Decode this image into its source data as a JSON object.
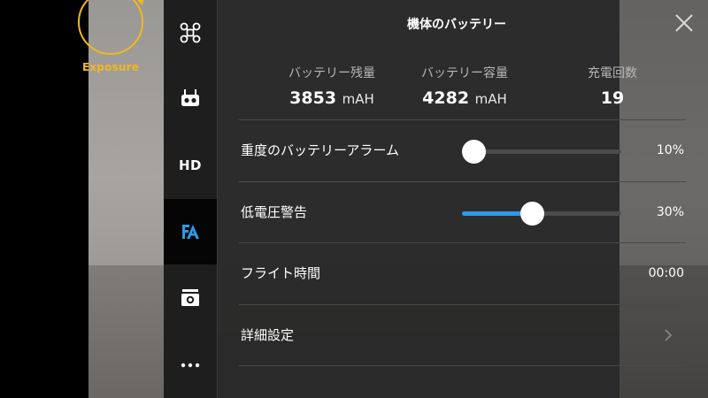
{
  "camera": {
    "exposure_label": "Exposure"
  },
  "sidebar": {
    "items": [
      {
        "id": "aircraft",
        "icon": "drone-icon"
      },
      {
        "id": "remote",
        "icon": "remote-controller-icon"
      },
      {
        "id": "hd",
        "label": "HD"
      },
      {
        "id": "battery",
        "icon": "battery-settings-icon",
        "active": true
      },
      {
        "id": "camera",
        "icon": "camera-icon"
      },
      {
        "id": "more",
        "icon": "more-icon"
      }
    ],
    "active_color": "#2b9ae8"
  },
  "panel": {
    "title": "機体のバッテリー",
    "stats": [
      {
        "label": "バッテリー残量",
        "value": "3853",
        "unit": "mAH"
      },
      {
        "label": "バッテリー容量",
        "value": "4282",
        "unit": "mAH"
      },
      {
        "label": "充電回数",
        "value": "19",
        "unit": ""
      }
    ],
    "rows": {
      "critical_alarm": {
        "label": "重度のバッテリーアラーム",
        "value": "10%",
        "level": 0.0
      },
      "low_voltage": {
        "label": "低電圧警告",
        "value": "30%",
        "level": 0.44
      },
      "flight_time": {
        "label": "フライト時間",
        "value": "00:00"
      },
      "advanced": {
        "label": "詳細設定"
      }
    }
  },
  "colors": {
    "accent": "#2b9ae8",
    "exposure": "#f3b71f"
  }
}
